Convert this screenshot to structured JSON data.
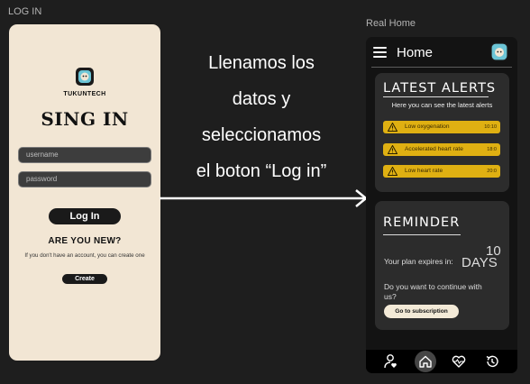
{
  "labels": {
    "login_frame": "LOG IN",
    "home_frame": "Real Home"
  },
  "login": {
    "brand": "TUKUNTECH",
    "title": "SING IN",
    "username_placeholder": "username",
    "password_placeholder": "password",
    "login_button": "Log In",
    "new_question": "ARE YOU NEW?",
    "hint": "If you don't have an account, you can create one",
    "create_button": "Create"
  },
  "caption": {
    "line1": "Llenamos los",
    "line2": "datos y",
    "line3": "seleccionamos",
    "line4": "el boton “Log in”"
  },
  "home": {
    "title": "Home",
    "alerts": {
      "title": "LATEST ALERTS",
      "subtitle": "Here you can see the latest alerts",
      "items": [
        {
          "label": "Low oxygenation",
          "time": "10:10"
        },
        {
          "label": "Accelerated heart rate",
          "time": "18:0"
        },
        {
          "label": "Low heart rate",
          "time": "20:0"
        }
      ]
    },
    "reminder": {
      "title": "REMINDER",
      "plan_text": "Your plan expires in:",
      "plan_number": "10",
      "plan_unit": "DAYS",
      "continue_question": "Do you want to continue with us?",
      "subscription_button": "Go to subscription"
    },
    "tabs": [
      "profile-heart",
      "home",
      "heart-rate",
      "history"
    ]
  },
  "colors": {
    "login_bg": "#f2e6d4",
    "alert_yellow": "#dfb012",
    "dark_card": "#2c2c2c"
  }
}
